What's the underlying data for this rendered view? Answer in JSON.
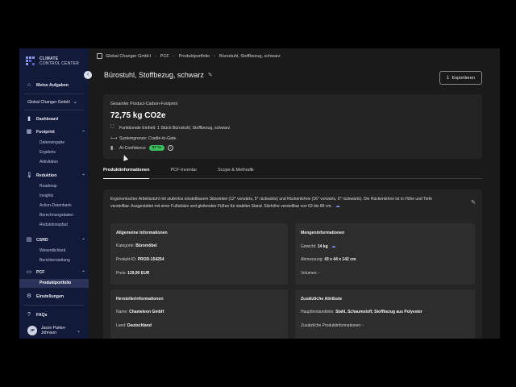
{
  "sidebar": {
    "logo": {
      "line1": "CLIMATE",
      "line2": "CONTROL CENTER"
    },
    "my_tasks": "Meine Aufgaben",
    "company": "Global Changer GmbH",
    "dashboard": "Dashboard",
    "footprint": {
      "label": "Footprint",
      "items": [
        "Dateneingabe",
        "Ergebnis",
        "Aktivitäten"
      ]
    },
    "reduction": {
      "label": "Reduktion",
      "items": [
        "Roadmap",
        "Insights",
        "Action-Datenbank",
        "Berechnungsdaten",
        "Reduktionspfad"
      ]
    },
    "csrd": {
      "label": "CSRD",
      "items": [
        "Wesentlichkeit",
        "Berichterstattung"
      ]
    },
    "pcf": {
      "label": "PCF",
      "items": [
        "Produktportfolio"
      ]
    },
    "settings": "Einstellungen",
    "faqs": "FAQs",
    "user": {
      "initials": "JP",
      "name": "Jason Parker-Johnson"
    }
  },
  "breadcrumb": [
    "Global Changer GmbH",
    "PCF",
    "Produktportfolio",
    "Bürostuhl, Stoffbezug, schwarz"
  ],
  "page_title": "Bürostuhl, Stoffbezug, schwarz",
  "export_label": "Exportieren",
  "pcf_summary": {
    "label": "Gesamter Product-Carbon-Footprint",
    "value": "72,75 kg CO2e",
    "functional_unit": "Funktionale Einheit: 1 Stück Bürostuhl, Stoffbezug, schwarz",
    "system_boundary": "Systemgrenze: Cradle-to-Gate",
    "ai_confidence_label": "AI-Confidence",
    "ai_confidence_value": "87 %"
  },
  "tabs": [
    "Produktinformationen",
    "PCF-Inventar",
    "Scope & Methodik"
  ],
  "description": "Ergonomischer Arbeitsstuhl mit stufenlos einstellbarem Sitzwinkel (12° vorwärts, 5° rückwärts) und Rückenlehne (16° vorwärts, 6° rückwärts). Die Rückenlehne ist in Höhe und Tiefe verstellbar. Ausgestattet mit einer Fußstütze und gleitenden Füßen für stabilen Stand. Sitzhöhe verstellbar von 63 bis 89 cm.",
  "general_info": {
    "title": "Allgemeine Informationen",
    "category_label": "Kategorie:",
    "category": "Büromöbel",
    "product_id_label": "Produkt-ID:",
    "product_id": "PROD-154254",
    "price_label": "Preis:",
    "price": "129,90 EUR"
  },
  "quantity_info": {
    "title": "Mengeninformationen",
    "weight_label": "Gewicht:",
    "weight": "14 kg",
    "dimensions_label": "Abmessung:",
    "dimensions": "43 x 44 x 142 cm",
    "volume_label": "Volumen:",
    "volume": "-"
  },
  "manufacturer_info": {
    "title": "Herstellerinformationen",
    "name_label": "Name:",
    "name": "Chameleon GmbH",
    "country_label": "Land:",
    "country": "Deutschland"
  },
  "additional_attrs": {
    "title": "Zusätzliche Attribute",
    "components_label": "Hauptbestandteile:",
    "components": "Stahl, Schaumstoff, Stoffbezug aus Polyester",
    "extra_label": "Zusätzliche Produktinformationen:",
    "extra": "-"
  },
  "colors": {
    "sidebar": "#121a3a",
    "accent_green": "#3bbf5e",
    "ai_blue": "#7f88e0"
  }
}
